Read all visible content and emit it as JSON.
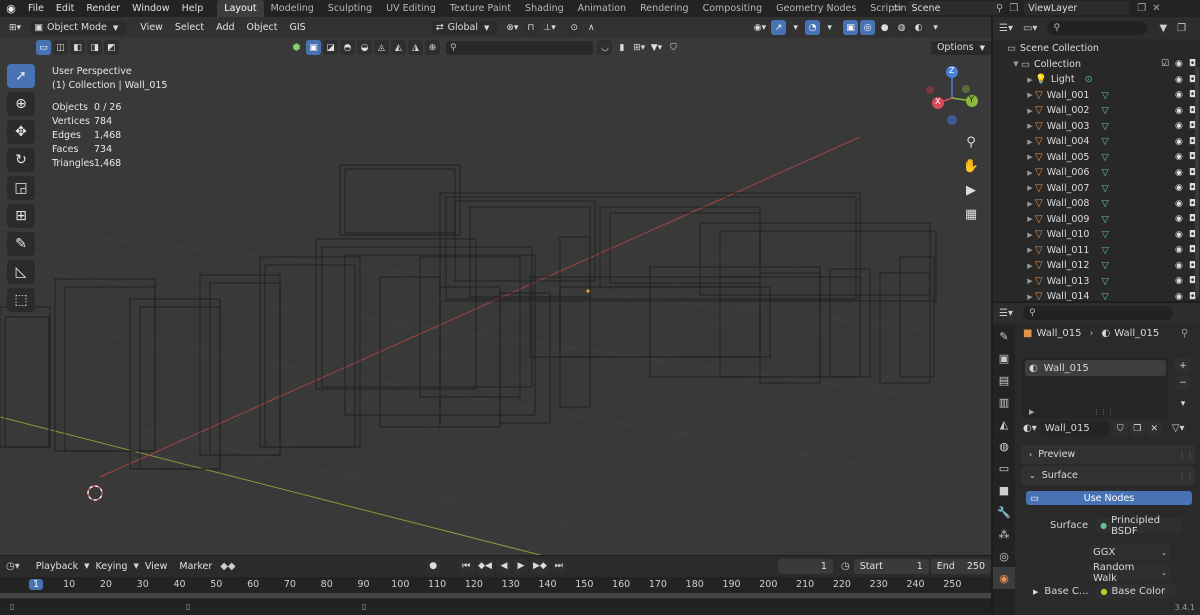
{
  "topbar": {
    "menus": [
      "File",
      "Edit",
      "Render",
      "Window",
      "Help"
    ],
    "workspaces": [
      "Layout",
      "Modeling",
      "Sculpting",
      "UV Editing",
      "Texture Paint",
      "Shading",
      "Animation",
      "Rendering",
      "Compositing",
      "Geometry Nodes",
      "Scripting"
    ],
    "active_workspace": "Layout",
    "scene": "Scene",
    "view_layer": "ViewLayer"
  },
  "viewport": {
    "mode": "Object Mode",
    "menus": [
      "View",
      "Select",
      "Add",
      "Object",
      "GIS"
    ],
    "orientation": "Global",
    "options_label": "Options",
    "perspective": "User Perspective",
    "collection_line": "(1) Collection | Wall_015",
    "stats": [
      {
        "label": "Objects",
        "value": "0 / 26"
      },
      {
        "label": "Vertices",
        "value": "784"
      },
      {
        "label": "Edges",
        "value": "1,468"
      },
      {
        "label": "Faces",
        "value": "734"
      },
      {
        "label": "Triangles",
        "value": "1,468"
      }
    ],
    "gizmo": {
      "z": "Z",
      "y": "Y",
      "x": "X"
    }
  },
  "outliner": {
    "root": "Scene Collection",
    "collection": "Collection",
    "light": "Light",
    "walls": [
      "Wall_001",
      "Wall_002",
      "Wall_003",
      "Wall_004",
      "Wall_005",
      "Wall_006",
      "Wall_007",
      "Wall_008",
      "Wall_009",
      "Wall_010",
      "Wall_011",
      "Wall_012",
      "Wall_013",
      "Wall_014"
    ]
  },
  "properties": {
    "object_name": "Wall_015",
    "material_name": "Wall_015",
    "slot_name": "Wall_015",
    "material_field": "Wall_015",
    "preview_label": "Preview",
    "surface_label": "Surface",
    "use_nodes_label": "Use Nodes",
    "surface_field_label": "Surface",
    "surface_value": "Principled BSDF",
    "distribution": "GGX",
    "subsurface": "Random Walk",
    "base_color_label": "Base C...",
    "base_color_value": "Base Color",
    "version": "3.4.1"
  },
  "timeline": {
    "menus": [
      "Playback",
      "Keying",
      "View",
      "Marker"
    ],
    "current_frame": "1",
    "start_label": "Start",
    "start_value": "1",
    "end_label": "End",
    "end_value": "250",
    "ticks": [
      "1",
      "10",
      "20",
      "30",
      "40",
      "50",
      "60",
      "70",
      "80",
      "90",
      "100",
      "110",
      "120",
      "130",
      "140",
      "150",
      "160",
      "170",
      "180",
      "190",
      "200",
      "210",
      "220",
      "230",
      "240",
      "250"
    ]
  }
}
